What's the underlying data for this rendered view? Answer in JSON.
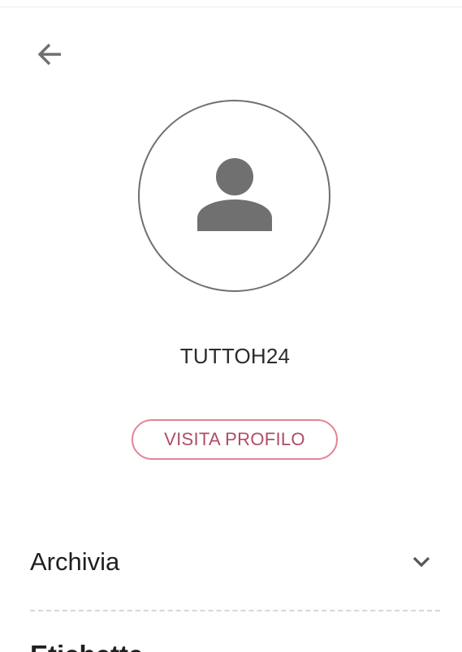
{
  "profile": {
    "username": "TUTTOH24",
    "visit_label": "VISITA PROFILO"
  },
  "sections": {
    "archivia": "Archivia",
    "next_partial": "Etichette"
  },
  "icons": {
    "back": "arrow-back-icon",
    "avatar": "person-icon",
    "expand": "chevron-down-icon"
  },
  "colors": {
    "accent_border": "#e58396",
    "accent_text": "#b04d64",
    "icon_gray": "#6f6f6f"
  }
}
